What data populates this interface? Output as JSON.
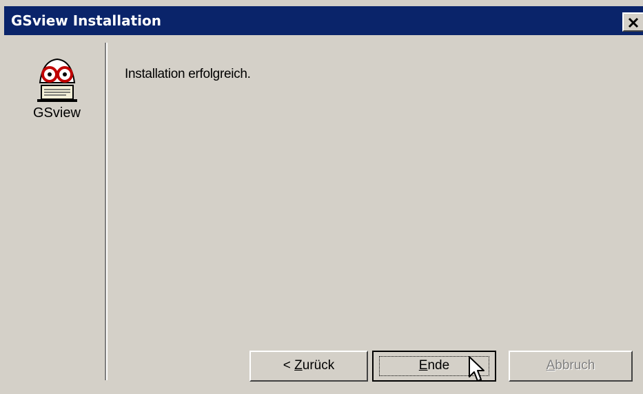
{
  "window": {
    "title": "GSview Installation",
    "close_icon": "close-icon"
  },
  "sidebar": {
    "icon": "gsview-logo-icon",
    "label": "GSview"
  },
  "content": {
    "message": "Installation erfolgreich."
  },
  "buttons": {
    "back": {
      "prefix": "< ",
      "mnemonic": "Z",
      "rest": "urück"
    },
    "finish": {
      "mnemonic": "E",
      "rest": "nde"
    },
    "cancel": {
      "mnemonic": "A",
      "rest": "bbruch",
      "disabled": true
    }
  },
  "colors": {
    "titlebar": "#0a246a",
    "dialog_bg": "#d4d0c8"
  }
}
